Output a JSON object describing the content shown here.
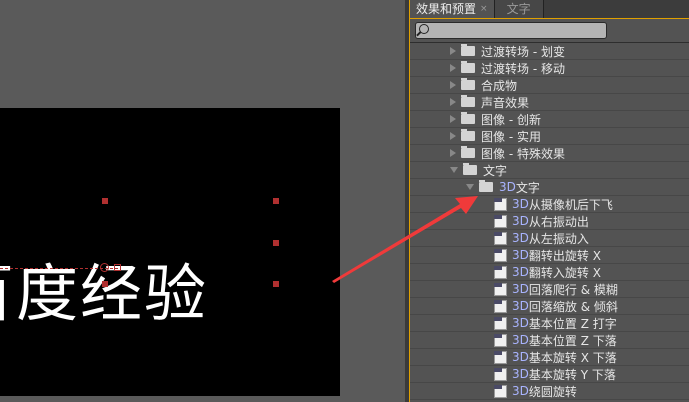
{
  "canvas": {
    "text": "百度经验"
  },
  "panel": {
    "tabs": [
      {
        "label": "效果和预置",
        "close": "×"
      },
      {
        "label": "文字"
      }
    ],
    "search": {
      "value": ""
    },
    "folders": [
      "过渡转场 - 划变",
      "过渡转场 - 移动",
      "合成物",
      "声音效果",
      "图像 - 创新",
      "图像 - 实用",
      "图像 - 特殊效果"
    ],
    "open_folder": "文字",
    "subfolder": {
      "prefix": "3D",
      "label": " 文字"
    },
    "presets": [
      {
        "p": "3D",
        "t": "从摄像机后下飞"
      },
      {
        "p": "3D",
        "t": "从右振动出"
      },
      {
        "p": "3D",
        "t": "从左振动入"
      },
      {
        "p": "3D",
        "t": "翻转出旋转 X"
      },
      {
        "p": "3D",
        "t": "翻转入旋转 X"
      },
      {
        "p": "3D",
        "t": "回落爬行 & 模糊"
      },
      {
        "p": "3D",
        "t": "回落缩放 & 倾斜"
      },
      {
        "p": "3D",
        "t": "基本位置 Z 打字"
      },
      {
        "p": "3D",
        "t": "基本位置 Z 下落"
      },
      {
        "p": "3D",
        "t": "基本旋转 X 下落"
      },
      {
        "p": "3D",
        "t": "基本旋转 Y 下落"
      },
      {
        "p": "3D",
        "t": "绕圆旋转"
      }
    ]
  },
  "colors": {
    "accent": "#e0a000",
    "annotation_arrow": "#f03a3a"
  }
}
